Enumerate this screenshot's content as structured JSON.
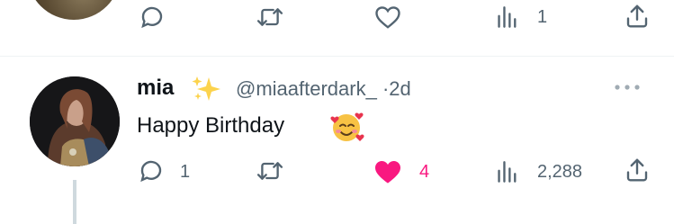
{
  "previous_tweet": {
    "actions": {
      "reply_count": "",
      "retweet_count": "",
      "like_count": "",
      "views_count": "1"
    }
  },
  "reply": {
    "display_name": "mia",
    "name_emoji": "sparkles-icon",
    "handle": "@miaafterdark_",
    "separator": "·",
    "time": "2d",
    "text": "Happy Birthday",
    "text_emoji": "smiling-face-with-hearts-icon",
    "actions": {
      "reply_count": "1",
      "retweet_count": "",
      "like_count": "4",
      "views_count": "2,288"
    }
  },
  "colors": {
    "like_active": "#f91880",
    "secondary_text": "#536471",
    "primary_text": "#0f1419",
    "thread_line": "#cfd9de"
  }
}
